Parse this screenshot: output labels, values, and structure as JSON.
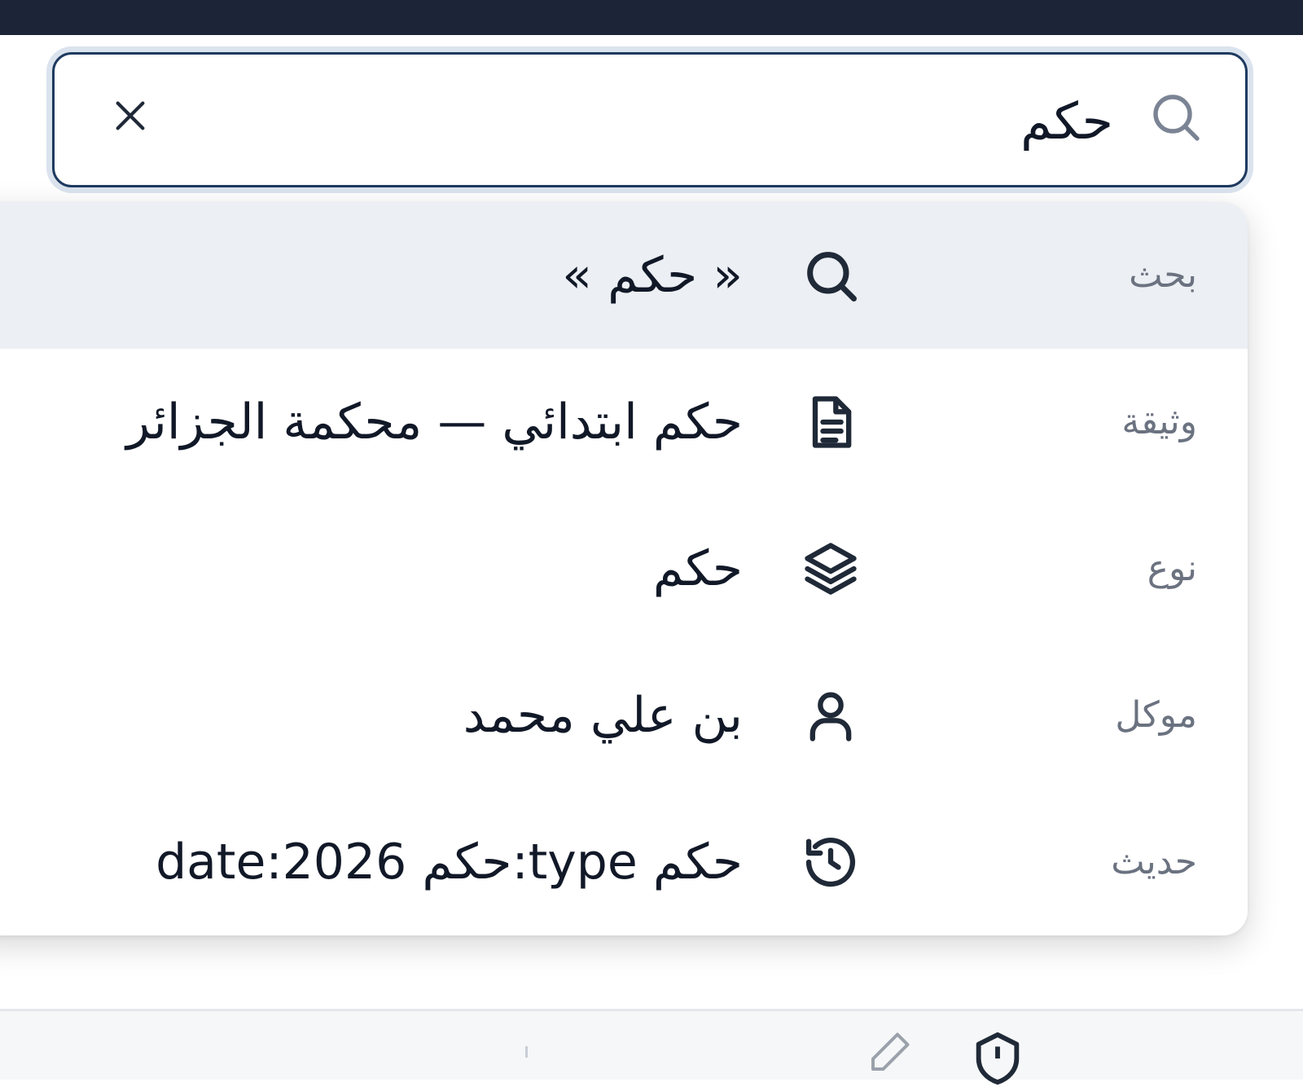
{
  "search": {
    "value": "حكم",
    "icon": "search-icon",
    "clear_icon": "close-icon"
  },
  "dropdown": {
    "items": [
      {
        "kind": "بحث",
        "icon": "search-icon",
        "text": "« حكم »",
        "active": true
      },
      {
        "kind": "وثيقة",
        "icon": "document-icon",
        "text": "حكم ابتدائي — محكمة الجزائر",
        "active": false
      },
      {
        "kind": "نوع",
        "icon": "layers-icon",
        "text": "حكم",
        "active": false
      },
      {
        "kind": "موكل",
        "icon": "user-icon",
        "text": "بن علي محمد",
        "active": false
      },
      {
        "kind": "حديث",
        "icon": "history-icon",
        "text": "حكم type:حكم date:2026",
        "active": false
      }
    ]
  },
  "colors": {
    "topbar": "#1c2538",
    "input_border": "#1e3a5f",
    "active_row": "#eceff3",
    "kind_text": "#6b7280",
    "main_text": "#111827"
  },
  "bottom_bar": {
    "icons": [
      "pencil-icon",
      "shield-icon"
    ]
  }
}
